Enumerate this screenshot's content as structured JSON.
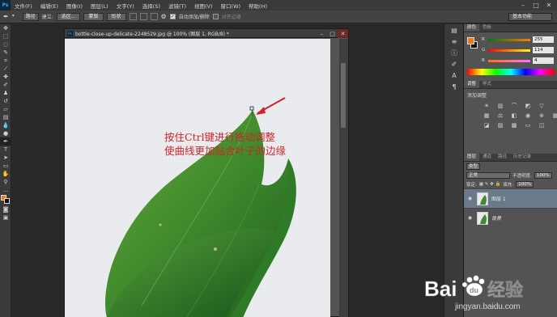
{
  "menubar": {
    "logo": "Ps",
    "items": [
      "文件(F)",
      "编辑(E)",
      "图像(I)",
      "图层(L)",
      "文字(Y)",
      "选择(S)",
      "滤镜(T)",
      "视图(V)",
      "窗口(W)",
      "帮助(H)"
    ]
  },
  "options": {
    "mode": "路径",
    "build_label": "建立:",
    "selection_btn": "选区...",
    "mask_btn": "蒙版",
    "shape_btn": "形状",
    "auto_add_label": "自动添加/删除",
    "align_edges_label": "对齐边缘",
    "workspace": "基本功能"
  },
  "document": {
    "title": "bottle-close-up-delicate-2248529.jpg @ 100% (图层 1, RGB/8) *",
    "annotation_line1": "按住Ctrl键进行拖动调整",
    "annotation_line2": "使曲线更加贴合叶子的边缘"
  },
  "color_panel": {
    "tabs": [
      "颜色",
      "色板"
    ],
    "r_label": "R",
    "g_label": "G",
    "b_label": "B",
    "r": "255",
    "g": "114",
    "b": "4",
    "foreground": "#f07a12",
    "background": "#111111"
  },
  "adjustments_panel": {
    "tabs": [
      "调整",
      "样式"
    ],
    "title": "添加调整"
  },
  "layers_panel": {
    "tabs": [
      "图层",
      "通道",
      "路径",
      "历史记录"
    ],
    "kind": "类型",
    "blend_mode": "正常",
    "opacity_label": "不透明度:",
    "opacity": "100%",
    "lock_label": "锁定:",
    "fill_label": "填充:",
    "fill": "100%",
    "layers": [
      {
        "name": "图层 1",
        "selected": true
      },
      {
        "name": "背景",
        "selected": false
      }
    ]
  },
  "watermark": {
    "brand": "Bai",
    "paw": "du",
    "jingyan": "经验",
    "url": "jingyan.baidu.com"
  }
}
